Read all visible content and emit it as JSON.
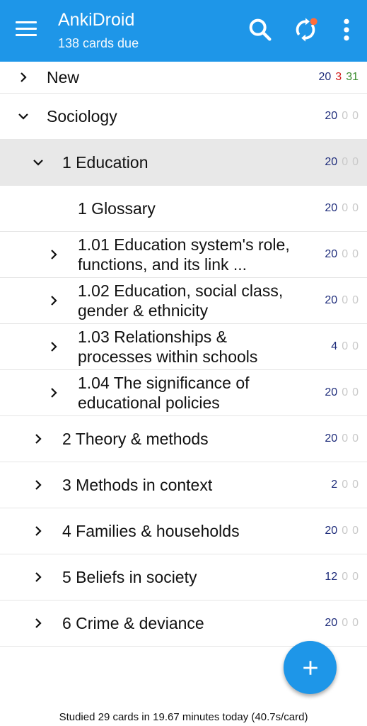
{
  "appbar": {
    "title": "AnkiDroid",
    "subtitle": "138 cards due",
    "icons": [
      "menu-icon",
      "search-icon",
      "sync-icon",
      "more-vert-icon"
    ],
    "sync_badge_color": "#ff6d3a",
    "bg_color": "#1e96e8"
  },
  "decks": [
    {
      "name": "New",
      "expanded": false,
      "counts": [
        "20",
        "3",
        "31"
      ]
    },
    {
      "name": "Sociology",
      "expanded": true,
      "counts": [
        "20",
        "0",
        "0"
      ]
    },
    {
      "name": "1 Education",
      "expanded": true,
      "selected": true,
      "counts": [
        "20",
        "0",
        "0"
      ]
    },
    {
      "name": "1 Glossary",
      "counts": [
        "20",
        "0",
        "0"
      ]
    },
    {
      "name": "1.01 Education system's role, functions, and its link ...",
      "counts": [
        "20",
        "0",
        "0"
      ]
    },
    {
      "name": "1.02 Education, social class, gender & ethnicity",
      "counts": [
        "20",
        "0",
        "0"
      ]
    },
    {
      "name": "1.03 Relationships & processes within schools",
      "counts": [
        "4",
        "0",
        "0"
      ]
    },
    {
      "name": "1.04 The significance of educational policies",
      "counts": [
        "20",
        "0",
        "0"
      ]
    },
    {
      "name": "2 Theory & methods",
      "counts": [
        "20",
        "0",
        "0"
      ]
    },
    {
      "name": "3 Methods in context",
      "counts": [
        "2",
        "0",
        "0"
      ]
    },
    {
      "name": "4 Families & households",
      "counts": [
        "20",
        "0",
        "0"
      ]
    },
    {
      "name": "5 Beliefs in society",
      "counts": [
        "12",
        "0",
        "0"
      ]
    },
    {
      "name": "6 Crime & deviance",
      "counts": [
        "20",
        "0",
        "0"
      ]
    }
  ],
  "fab": {
    "icon": "plus-icon"
  },
  "footer": {
    "text": "Studied 29 cards in 19.67 minutes today (40.7s/card)"
  }
}
